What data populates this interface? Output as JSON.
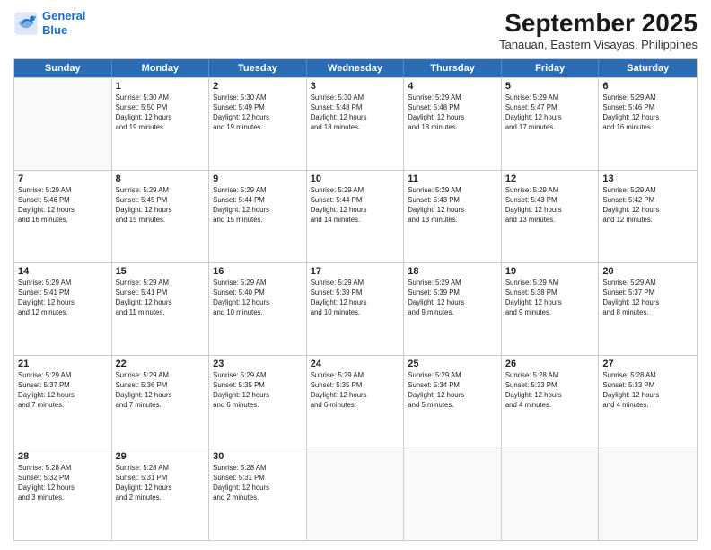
{
  "logo": {
    "line1": "General",
    "line2": "Blue"
  },
  "title": "September 2025",
  "location": "Tanauan, Eastern Visayas, Philippines",
  "days_of_week": [
    "Sunday",
    "Monday",
    "Tuesday",
    "Wednesday",
    "Thursday",
    "Friday",
    "Saturday"
  ],
  "weeks": [
    [
      {
        "day": "",
        "empty": true
      },
      {
        "day": "1",
        "sunrise": "5:30 AM",
        "sunset": "5:50 PM",
        "daylight": "12 hours and 19 minutes."
      },
      {
        "day": "2",
        "sunrise": "5:30 AM",
        "sunset": "5:49 PM",
        "daylight": "12 hours and 19 minutes."
      },
      {
        "day": "3",
        "sunrise": "5:30 AM",
        "sunset": "5:48 PM",
        "daylight": "12 hours and 18 minutes."
      },
      {
        "day": "4",
        "sunrise": "5:29 AM",
        "sunset": "5:48 PM",
        "daylight": "12 hours and 18 minutes."
      },
      {
        "day": "5",
        "sunrise": "5:29 AM",
        "sunset": "5:47 PM",
        "daylight": "12 hours and 17 minutes."
      },
      {
        "day": "6",
        "sunrise": "5:29 AM",
        "sunset": "5:46 PM",
        "daylight": "12 hours and 16 minutes."
      }
    ],
    [
      {
        "day": "7",
        "sunrise": "5:29 AM",
        "sunset": "5:46 PM",
        "daylight": "12 hours and 16 minutes."
      },
      {
        "day": "8",
        "sunrise": "5:29 AM",
        "sunset": "5:45 PM",
        "daylight": "12 hours and 15 minutes."
      },
      {
        "day": "9",
        "sunrise": "5:29 AM",
        "sunset": "5:44 PM",
        "daylight": "12 hours and 15 minutes."
      },
      {
        "day": "10",
        "sunrise": "5:29 AM",
        "sunset": "5:44 PM",
        "daylight": "12 hours and 14 minutes."
      },
      {
        "day": "11",
        "sunrise": "5:29 AM",
        "sunset": "5:43 PM",
        "daylight": "12 hours and 13 minutes."
      },
      {
        "day": "12",
        "sunrise": "5:29 AM",
        "sunset": "5:43 PM",
        "daylight": "12 hours and 13 minutes."
      },
      {
        "day": "13",
        "sunrise": "5:29 AM",
        "sunset": "5:42 PM",
        "daylight": "12 hours and 12 minutes."
      }
    ],
    [
      {
        "day": "14",
        "sunrise": "5:29 AM",
        "sunset": "5:41 PM",
        "daylight": "12 hours and 12 minutes."
      },
      {
        "day": "15",
        "sunrise": "5:29 AM",
        "sunset": "5:41 PM",
        "daylight": "12 hours and 11 minutes."
      },
      {
        "day": "16",
        "sunrise": "5:29 AM",
        "sunset": "5:40 PM",
        "daylight": "12 hours and 10 minutes."
      },
      {
        "day": "17",
        "sunrise": "5:29 AM",
        "sunset": "5:39 PM",
        "daylight": "12 hours and 10 minutes."
      },
      {
        "day": "18",
        "sunrise": "5:29 AM",
        "sunset": "5:39 PM",
        "daylight": "12 hours and 9 minutes."
      },
      {
        "day": "19",
        "sunrise": "5:29 AM",
        "sunset": "5:38 PM",
        "daylight": "12 hours and 9 minutes."
      },
      {
        "day": "20",
        "sunrise": "5:29 AM",
        "sunset": "5:37 PM",
        "daylight": "12 hours and 8 minutes."
      }
    ],
    [
      {
        "day": "21",
        "sunrise": "5:29 AM",
        "sunset": "5:37 PM",
        "daylight": "12 hours and 7 minutes."
      },
      {
        "day": "22",
        "sunrise": "5:29 AM",
        "sunset": "5:36 PM",
        "daylight": "12 hours and 7 minutes."
      },
      {
        "day": "23",
        "sunrise": "5:29 AM",
        "sunset": "5:35 PM",
        "daylight": "12 hours and 6 minutes."
      },
      {
        "day": "24",
        "sunrise": "5:29 AM",
        "sunset": "5:35 PM",
        "daylight": "12 hours and 6 minutes."
      },
      {
        "day": "25",
        "sunrise": "5:29 AM",
        "sunset": "5:34 PM",
        "daylight": "12 hours and 5 minutes."
      },
      {
        "day": "26",
        "sunrise": "5:28 AM",
        "sunset": "5:33 PM",
        "daylight": "12 hours and 4 minutes."
      },
      {
        "day": "27",
        "sunrise": "5:28 AM",
        "sunset": "5:33 PM",
        "daylight": "12 hours and 4 minutes."
      }
    ],
    [
      {
        "day": "28",
        "sunrise": "5:28 AM",
        "sunset": "5:32 PM",
        "daylight": "12 hours and 3 minutes."
      },
      {
        "day": "29",
        "sunrise": "5:28 AM",
        "sunset": "5:31 PM",
        "daylight": "12 hours and 2 minutes."
      },
      {
        "day": "30",
        "sunrise": "5:28 AM",
        "sunset": "5:31 PM",
        "daylight": "12 hours and 2 minutes."
      },
      {
        "day": "",
        "empty": true
      },
      {
        "day": "",
        "empty": true
      },
      {
        "day": "",
        "empty": true
      },
      {
        "day": "",
        "empty": true
      }
    ]
  ]
}
